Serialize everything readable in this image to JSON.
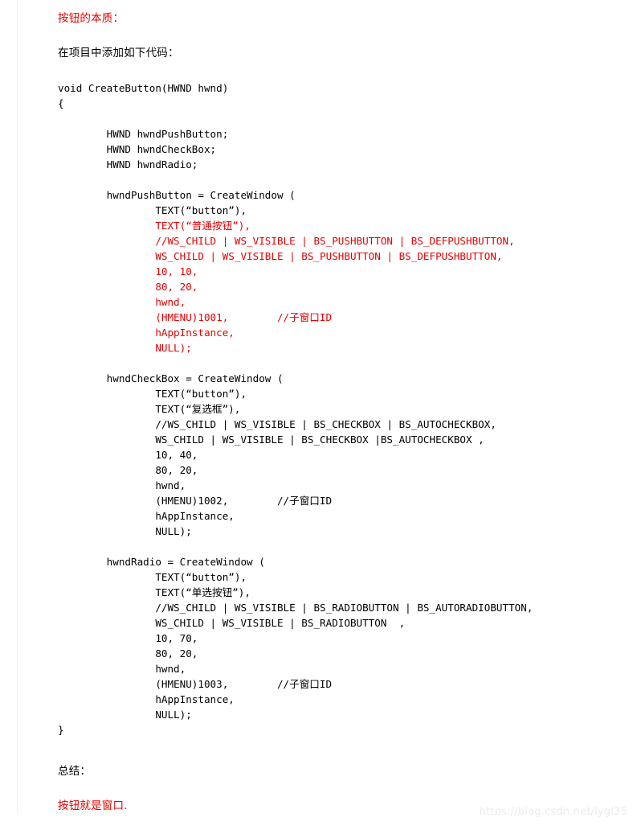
{
  "document": {
    "heading_red": "按钮的本质：",
    "intro": "在项目中添加如下代码：",
    "summary_label": "总结：",
    "summary_red": "按钮就是窗口.",
    "watermark": "https://blog.csdn.net/lygl35",
    "colors": {
      "red": "#e60000",
      "black": "#000000",
      "background": "#ffffff",
      "watermark": "#ececec",
      "rule": "#f2f2f2"
    }
  },
  "code": {
    "lines": [
      {
        "text": "void CreateButton(HWND hwnd)",
        "color": "black"
      },
      {
        "text": "{",
        "color": "black"
      },
      {
        "text": "",
        "color": "black"
      },
      {
        "text": "        HWND hwndPushButton;",
        "color": "black"
      },
      {
        "text": "        HWND hwndCheckBox;",
        "color": "black"
      },
      {
        "text": "        HWND hwndRadio;",
        "color": "black"
      },
      {
        "text": "",
        "color": "black"
      },
      {
        "text": "        hwndPushButton = CreateWindow (",
        "color": "black"
      },
      {
        "text": "                TEXT(“button”),",
        "color": "black"
      },
      {
        "text": "                TEXT(“普通按钮”),",
        "color": "red"
      },
      {
        "text": "                //WS_CHILD | WS_VISIBLE | BS_PUSHBUTTON | BS_DEFPUSHBUTTON,",
        "color": "red"
      },
      {
        "text": "                WS_CHILD | WS_VISIBLE | BS_PUSHBUTTON | BS_DEFPUSHBUTTON,",
        "color": "red"
      },
      {
        "text": "                10, 10,",
        "color": "red"
      },
      {
        "text": "                80, 20,",
        "color": "red"
      },
      {
        "text": "                hwnd,",
        "color": "red"
      },
      {
        "text": "                (HMENU)1001,        //子窗口ID",
        "color": "red"
      },
      {
        "text": "                hAppInstance,",
        "color": "red"
      },
      {
        "text": "                NULL);",
        "color": "red"
      },
      {
        "text": "",
        "color": "black"
      },
      {
        "text": "        hwndCheckBox = CreateWindow (",
        "color": "black"
      },
      {
        "text": "                TEXT(“button”),",
        "color": "black"
      },
      {
        "text": "                TEXT(“复选框”),",
        "color": "black"
      },
      {
        "text": "                //WS_CHILD | WS_VISIBLE | BS_CHECKBOX | BS_AUTOCHECKBOX,",
        "color": "black"
      },
      {
        "text": "                WS_CHILD | WS_VISIBLE | BS_CHECKBOX |BS_AUTOCHECKBOX ,",
        "color": "black"
      },
      {
        "text": "                10, 40,",
        "color": "black"
      },
      {
        "text": "                80, 20,",
        "color": "black"
      },
      {
        "text": "                hwnd,",
        "color": "black"
      },
      {
        "text": "                (HMENU)1002,        //子窗口ID",
        "color": "black"
      },
      {
        "text": "                hAppInstance,",
        "color": "black"
      },
      {
        "text": "                NULL);",
        "color": "black"
      },
      {
        "text": "",
        "color": "black"
      },
      {
        "text": "        hwndRadio = CreateWindow (",
        "color": "black"
      },
      {
        "text": "                TEXT(“button”),",
        "color": "black"
      },
      {
        "text": "                TEXT(“单选按钮”),",
        "color": "black"
      },
      {
        "text": "                //WS_CHILD | WS_VISIBLE | BS_RADIOBUTTON | BS_AUTORADIOBUTTON,",
        "color": "black"
      },
      {
        "text": "                WS_CHILD | WS_VISIBLE | BS_RADIOBUTTON  ,",
        "color": "black"
      },
      {
        "text": "                10, 70,",
        "color": "black"
      },
      {
        "text": "                80, 20,",
        "color": "black"
      },
      {
        "text": "                hwnd,",
        "color": "black"
      },
      {
        "text": "                (HMENU)1003,        //子窗口ID",
        "color": "black"
      },
      {
        "text": "                hAppInstance,",
        "color": "black"
      },
      {
        "text": "                NULL);",
        "color": "black"
      },
      {
        "text": "}",
        "color": "black"
      }
    ]
  }
}
